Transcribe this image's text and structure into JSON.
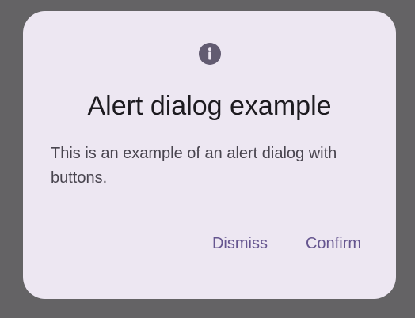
{
  "dialog": {
    "icon": "info-icon",
    "title": "Alert dialog example",
    "text": "This is an example of an alert dialog with buttons.",
    "dismiss_label": "Dismiss",
    "confirm_label": "Confirm"
  },
  "colors": {
    "scrim": "#646365",
    "surface": "#EDE7F2",
    "primary": "#65558F",
    "on_surface": "#1D1B20",
    "on_surface_variant": "#49454F",
    "icon": "#625B71"
  }
}
